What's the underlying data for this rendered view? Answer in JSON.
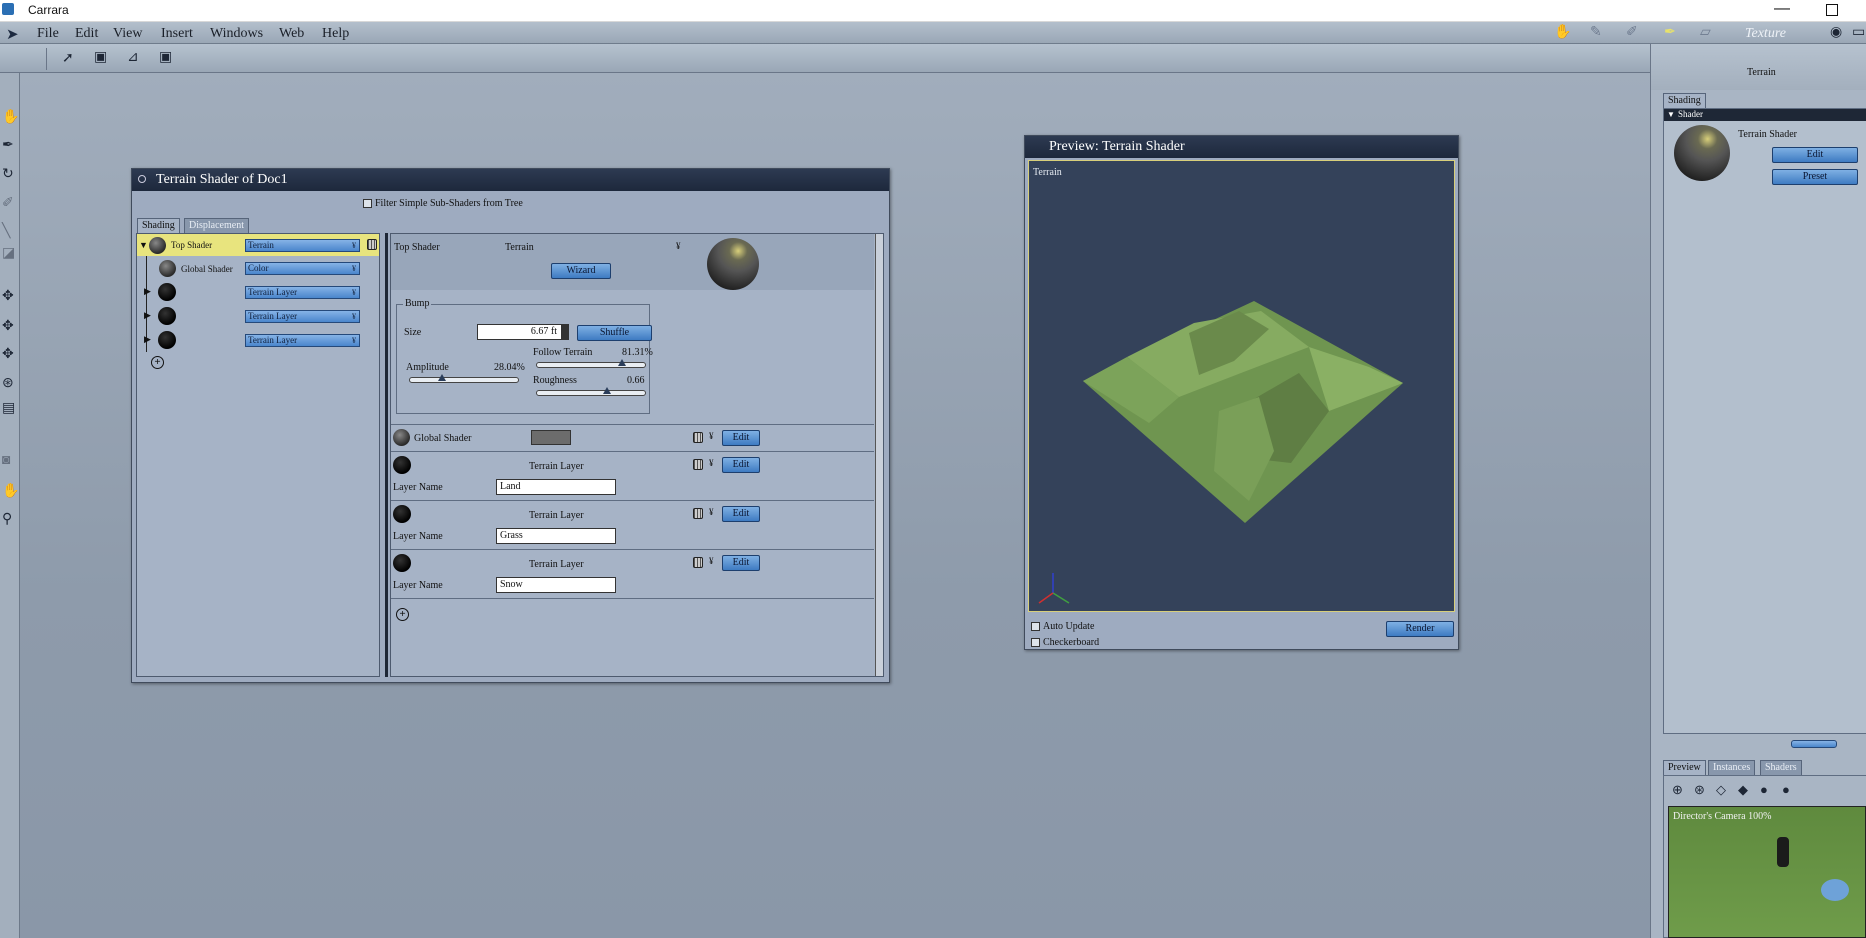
{
  "app": {
    "title": "Carrara",
    "room_label": "Texture"
  },
  "menu": [
    "File",
    "Edit",
    "View",
    "Insert",
    "Windows",
    "Web",
    "Help"
  ],
  "shader_window": {
    "title": "Terrain Shader of Doc1",
    "filter_label": "Filter Simple Sub-Shaders from Tree",
    "tabs": [
      "Shading",
      "Displacement"
    ],
    "tree": [
      {
        "label": "Top Shader",
        "value": "Terrain"
      },
      {
        "label": "Global Shader",
        "value": "Color"
      },
      {
        "label": "",
        "value": "Terrain Layer"
      },
      {
        "label": "",
        "value": "Terrain Layer"
      },
      {
        "label": "",
        "value": "Terrain Layer"
      }
    ],
    "top": {
      "label": "Top Shader",
      "type": "Terrain",
      "wizard": "Wizard"
    },
    "bump": {
      "group": "Bump",
      "size_label": "Size",
      "size_value": "6.67 ft",
      "shuffle": "Shuffle",
      "follow_label": "Follow Terrain",
      "follow_value": "81.31%",
      "follow_level": 0.8131,
      "amplitude_label": "Amplitude",
      "amplitude_value": "28.04%",
      "amplitude_level": 0.2804,
      "roughness_label": "Roughness",
      "roughness_value": "0.66",
      "roughness_level": 0.66
    },
    "global_row": {
      "label": "Global Shader",
      "edit": "Edit"
    },
    "layers": [
      {
        "title": "Terrain Layer",
        "name_label": "Layer Name",
        "name": "Land",
        "edit": "Edit"
      },
      {
        "title": "Terrain Layer",
        "name_label": "Layer Name",
        "name": "Grass",
        "edit": "Edit"
      },
      {
        "title": "Terrain Layer",
        "name_label": "Layer Name",
        "name": "Snow",
        "edit": "Edit"
      }
    ]
  },
  "preview_window": {
    "title": "Preview: Terrain Shader",
    "canvas_label": "Terrain",
    "auto_update": "Auto Update",
    "checkerboard": "Checkerboard",
    "render": "Render"
  },
  "right_panel": {
    "header": "Terrain",
    "tab": "Shading",
    "section": "Shader",
    "shader_name": "Terrain Shader",
    "edit": "Edit",
    "preset": "Preset",
    "bottom_tabs": [
      "Preview",
      "Instances",
      "Shaders"
    ],
    "camera_label": "Director's Camera 100%"
  },
  "colors": {
    "terrain_green": "#7fa35a",
    "preview_bg": "#34425a",
    "accent_blue": "#4a86cc"
  }
}
